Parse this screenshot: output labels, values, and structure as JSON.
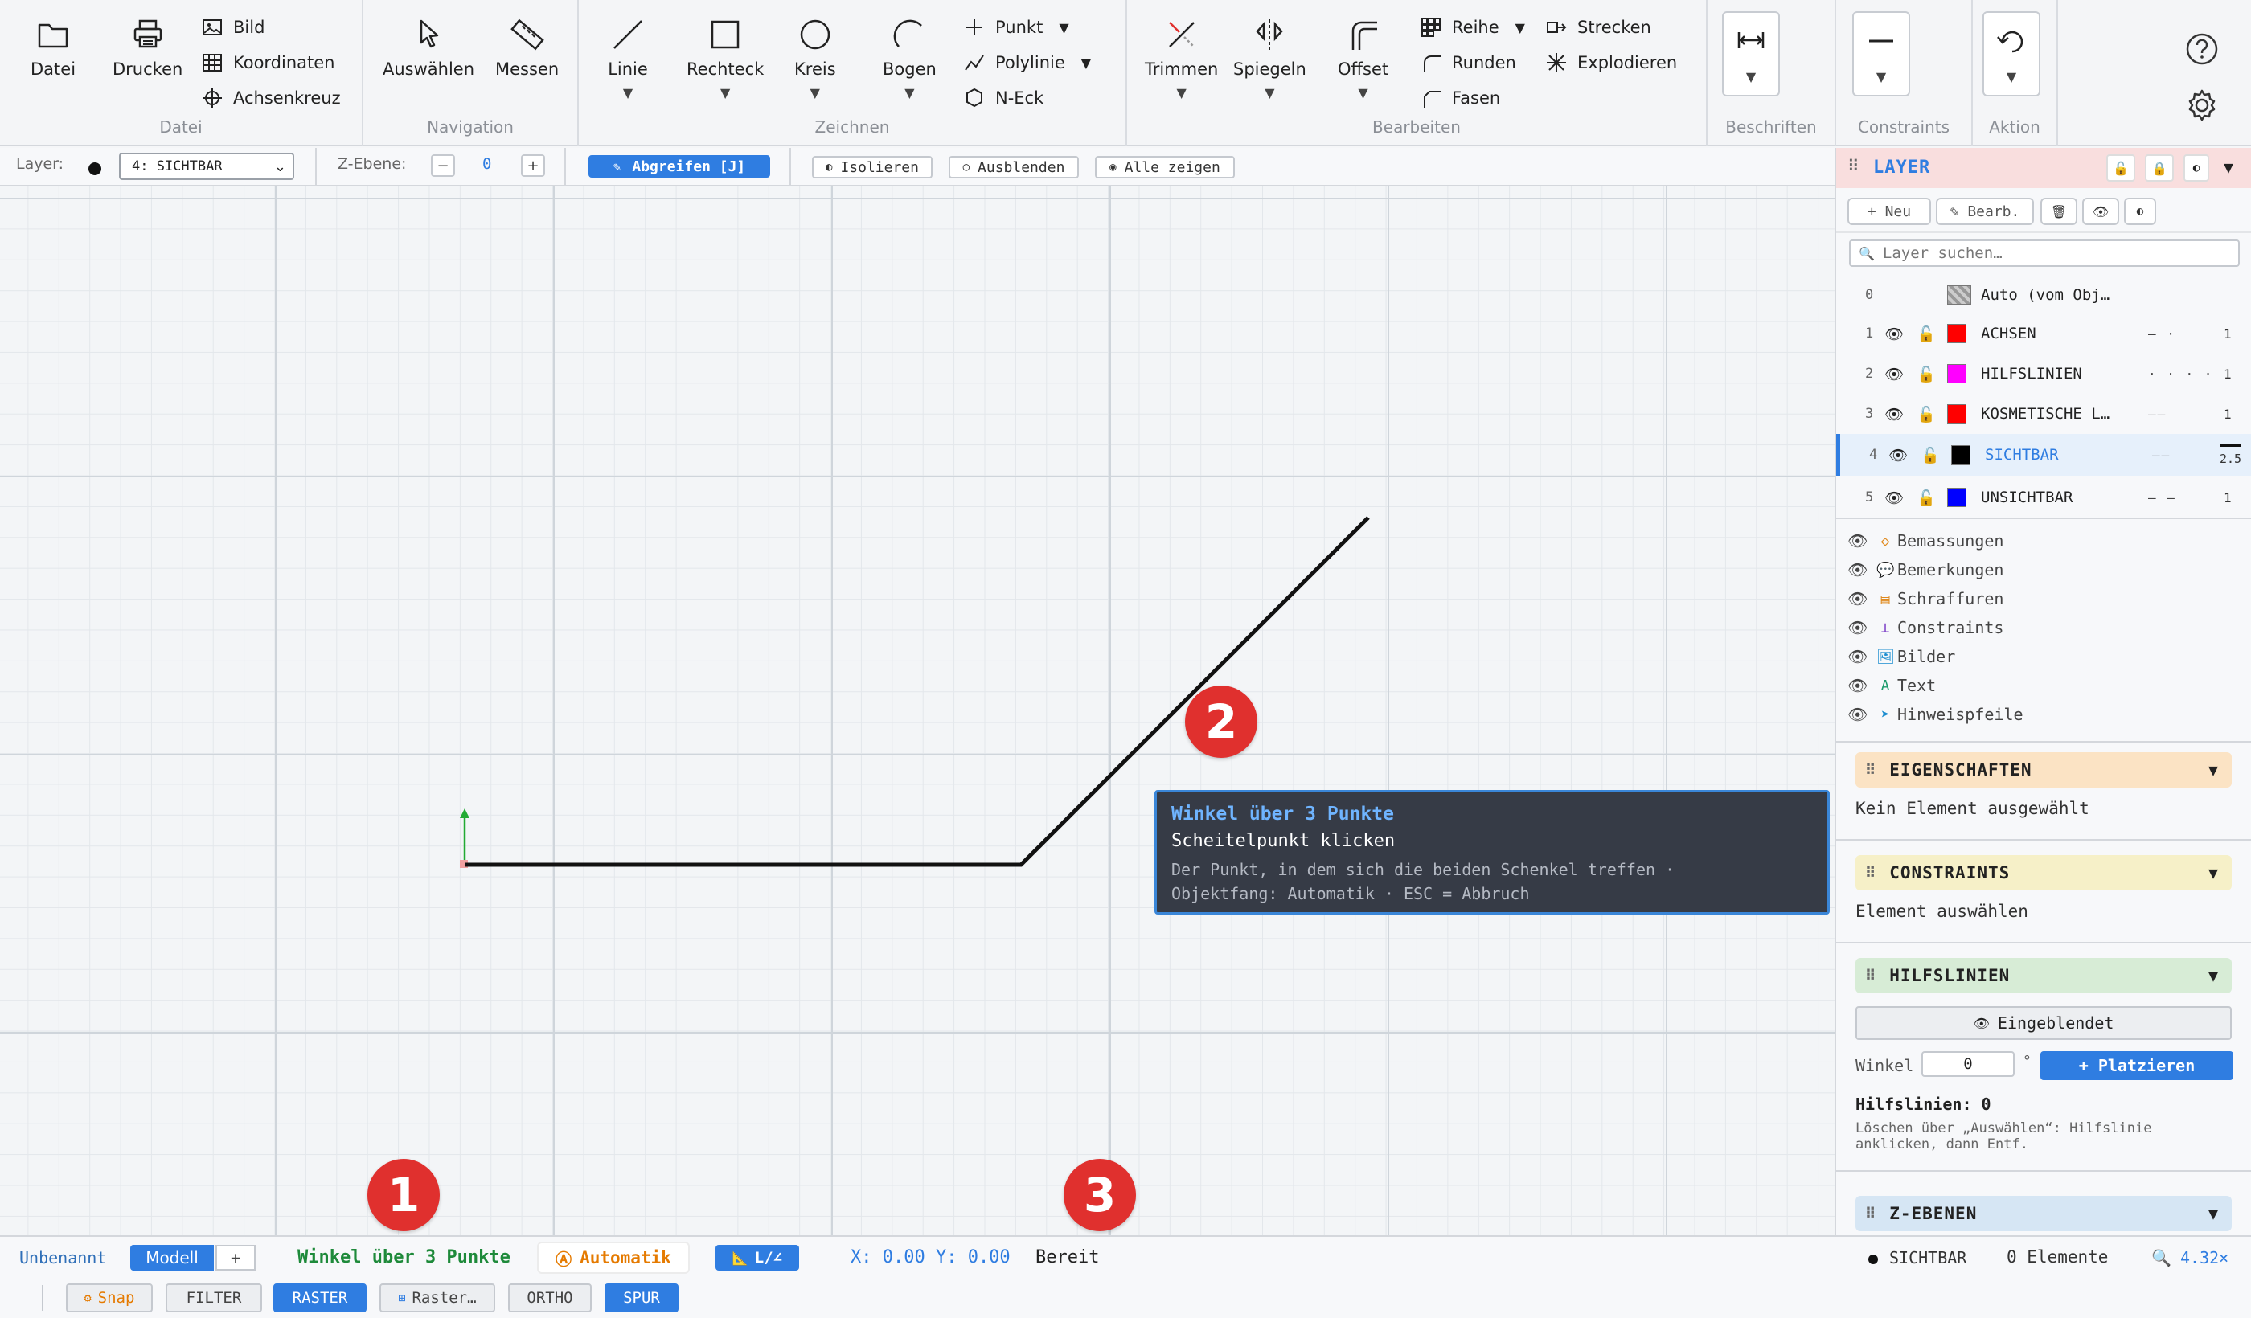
{
  "ribbon": {
    "datei": {
      "title": "Datei",
      "datei": "Datei",
      "drucken": "Drucken",
      "bild": "Bild",
      "koordinaten": "Koordinaten",
      "achsenkreuz": "Achsenkreuz"
    },
    "navigation": {
      "title": "Navigation",
      "auswaehlen": "Auswählen",
      "messen": "Messen"
    },
    "zeichnen": {
      "title": "Zeichnen",
      "linie": "Linie",
      "rechteck": "Rechteck",
      "kreis": "Kreis",
      "bogen": "Bogen",
      "punkt": "Punkt",
      "polylinie": "Polylinie",
      "neck": "N-Eck"
    },
    "bearbeiten": {
      "title": "Bearbeiten",
      "trimmen": "Trimmen",
      "spiegeln": "Spiegeln",
      "offset": "Offset",
      "reihe": "Reihe",
      "runden": "Runden",
      "fasen": "Fasen",
      "strecken": "Strecken",
      "explodieren": "Explodieren"
    },
    "beschriften": {
      "title": "Beschriften"
    },
    "constraints": {
      "title": "Constraints"
    },
    "aktion": {
      "title": "Aktion"
    }
  },
  "layerbar": {
    "layer_label": "Layer:",
    "layer_value": "4: SICHTBAR",
    "zebene_label": "Z-Ebene:",
    "zebene_minus": "−",
    "zebene_value": "0",
    "zebene_plus": "+",
    "abgreifen": "Abgreifen [J]",
    "isolieren": "Isolieren",
    "ausblenden": "Ausblenden",
    "alle_zeigen": "Alle zeigen"
  },
  "canvas": {
    "markers": [
      "1",
      "2",
      "3"
    ],
    "tooltip": {
      "title": "Winkel über 3 Punkte",
      "instruction": "Scheitelpunkt klicken",
      "hint_line1": "Der Punkt, in dem sich die beiden Schenkel treffen ·",
      "hint_line2": "Objektfang: Automatik · ESC = Abbruch"
    }
  },
  "status": {
    "doc_name": "Unbenannt",
    "tab_model": "Modell",
    "tab_add": "+",
    "command": "Winkel über 3 Punkte",
    "snap_mode": "Automatik",
    "angle_mode": "L/∠",
    "coords": "X: 0.00 Y: 0.00",
    "state": "Bereit",
    "layer": "SICHTBAR",
    "elements": "0 Elemente",
    "zoom": "4.32×",
    "toggles": {
      "snap": "Snap",
      "filter": "FILTER",
      "raster": "RASTER",
      "raster_opt": "Raster…",
      "ortho": "ORTHO",
      "spur": "SPUR"
    }
  },
  "side": {
    "layer_title": "LAYER",
    "layer_buttons": {
      "neu": "+ Neu",
      "bearb": "✎ Bearb."
    },
    "search_placeholder": "Layer suchen…",
    "layers": [
      {
        "num": "0",
        "name": "Auto (vom Obj…",
        "color": "auto",
        "lt": "",
        "lw": ""
      },
      {
        "num": "1",
        "name": "ACHSEN",
        "color": "#ff0000",
        "lt": "— ·",
        "lw": "1"
      },
      {
        "num": "2",
        "name": "HILFSLINIEN",
        "color": "#ff00ff",
        "lt": "· · · ·",
        "lw": "1"
      },
      {
        "num": "3",
        "name": "KOSMETISCHE L…",
        "color": "#ff0000",
        "lt": "——",
        "lw": "1"
      },
      {
        "num": "4",
        "name": "SICHTBAR",
        "color": "#000000",
        "lt": "——",
        "lw": "2.5"
      },
      {
        "num": "5",
        "name": "UNSICHTBAR",
        "color": "#0000ff",
        "lt": "— —",
        "lw": "1"
      }
    ],
    "objects": [
      {
        "icon": "◇",
        "name": "Bemassungen",
        "color": "#e08a1e"
      },
      {
        "icon": "💬",
        "name": "Bemerkungen",
        "color": "#666"
      },
      {
        "icon": "▤",
        "name": "Schraffuren",
        "color": "#e08a1e"
      },
      {
        "icon": "⊥",
        "name": "Constraints",
        "color": "#7a3cc6"
      },
      {
        "icon": "🖼",
        "name": "Bilder",
        "color": "#1a8ccf"
      },
      {
        "icon": "A",
        "name": "Text",
        "color": "#1a9a6a"
      },
      {
        "icon": "➤",
        "name": "Hinweispfeile",
        "color": "#1a8ccf"
      }
    ],
    "eigenschaften": {
      "title": "EIGENSCHAFTEN",
      "text": "Kein Element ausgewählt"
    },
    "constraints": {
      "title": "CONSTRAINTS",
      "text": "Element auswählen"
    },
    "hilfslinien": {
      "title": "HILFSLINIEN",
      "toggle": "Eingeblendet",
      "winkel_label": "Winkel",
      "winkel_value": "0",
      "degree": "°",
      "platzieren": "+ Platzieren",
      "count_label": "Hilfslinien:",
      "count": "0",
      "hint": "Löschen über „Auswählen“: Hilfslinie anklicken, dann Entf."
    },
    "zebenen": {
      "title": "Z-EBENEN"
    }
  },
  "colors": {
    "accent": "#2f7de1",
    "marker": "#e0302e",
    "layer_header": "#f9dede",
    "eigenschaften": "#fbe3c4",
    "constraints": "#f6f0c8",
    "hilfslinien": "#d7ecd6",
    "zebenen": "#d6e6f4"
  }
}
